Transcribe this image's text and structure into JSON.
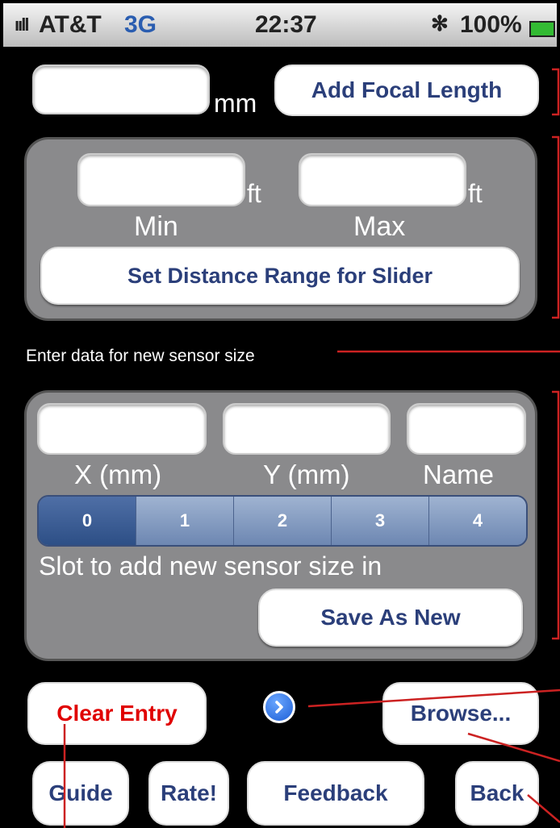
{
  "status": {
    "signal": "ııll",
    "carrier": "AT&T",
    "network": "3G",
    "time": "22:37",
    "bluetooth": "✻",
    "battery": "100%"
  },
  "focal": {
    "unit": "mm",
    "button": "Add Focal Length",
    "value": ""
  },
  "distance": {
    "min_unit": "ft",
    "max_unit": "ft",
    "min_label": "Min",
    "max_label": "Max",
    "button": "Set Distance Range for Slider"
  },
  "sensor": {
    "heading": "Enter data for new sensor size",
    "x_label": "X (mm)",
    "y_label": "Y (mm)",
    "name_label": "Name",
    "slots": [
      "0",
      "1",
      "2",
      "3",
      "4"
    ],
    "selected_slot": "0",
    "slot_caption": "Slot to add new sensor size in",
    "save_button": "Save As New"
  },
  "actions": {
    "clear": "Clear Entry",
    "browse": "Browse...",
    "guide": "Guide",
    "rate": "Rate!",
    "feedback": "Feedback",
    "back": "Back"
  },
  "colors": {
    "accent_red": "#e00000",
    "button_text": "#2b3f7a",
    "panel": "#8a8a8c",
    "callout": "#cc2222"
  }
}
